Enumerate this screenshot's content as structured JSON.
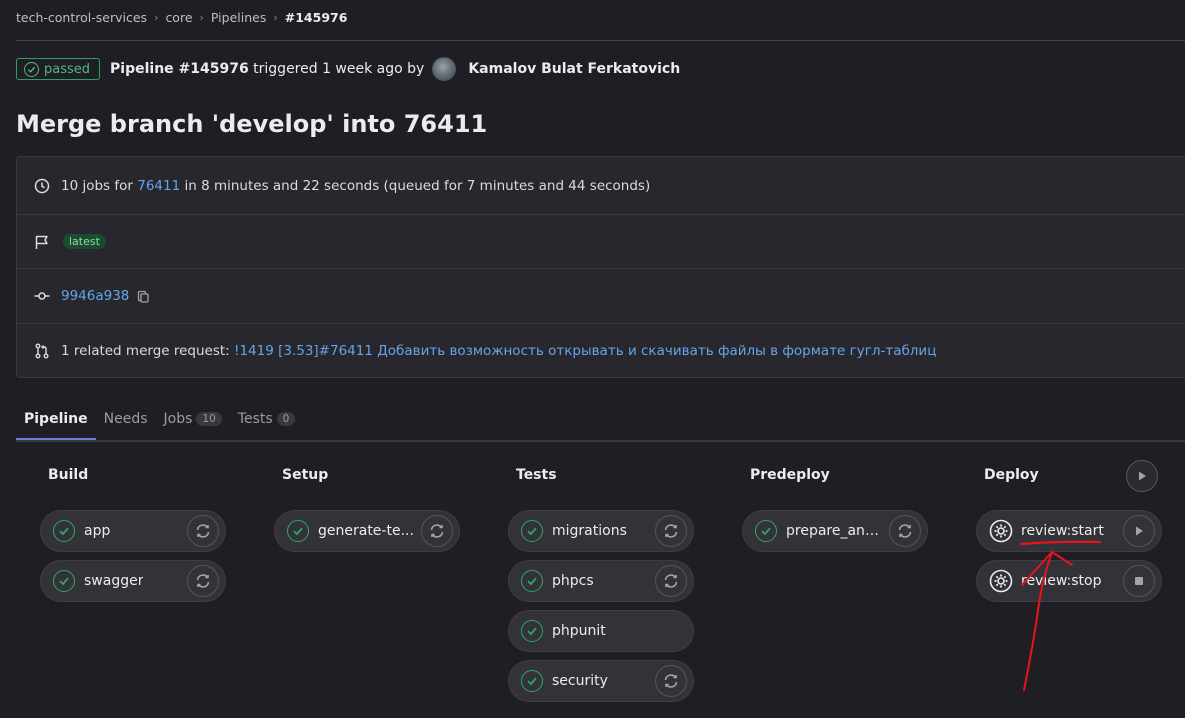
{
  "breadcrumb": {
    "items": [
      "tech-control-services",
      "core",
      "Pipelines"
    ],
    "current": "#145976"
  },
  "header": {
    "status": "passed",
    "pipeline": "Pipeline #145976",
    "triggered": "triggered 1 week ago by",
    "author": "Kamalov Bulat Ferkatovich",
    "title": "Merge branch 'develop' into 76411"
  },
  "info": {
    "jobs_prefix": "10 jobs for",
    "branch": "76411",
    "jobs_suffix": "in 8 minutes and 22 seconds (queued for 7 minutes and 44 seconds)",
    "tag": "latest",
    "commit": "9946a938",
    "mr_prefix": "1 related merge request:",
    "mr_link": "!1419 [3.53]#76411 Добавить возможность открывать и скачивать файлы в формате гугл-таблиц"
  },
  "tabs": [
    {
      "label": "Pipeline"
    },
    {
      "label": "Needs"
    },
    {
      "label": "Jobs",
      "count": "10"
    },
    {
      "label": "Tests",
      "count": "0"
    }
  ],
  "stages": [
    {
      "name": "Build",
      "jobs": [
        "app",
        "swagger"
      ]
    },
    {
      "name": "Setup",
      "jobs": [
        "generate-te..."
      ]
    },
    {
      "name": "Tests",
      "jobs": [
        "migrations",
        "phpcs",
        "phpunit",
        "security"
      ]
    },
    {
      "name": "Predeploy",
      "jobs": [
        "prepare_and_..."
      ]
    },
    {
      "name": "Deploy",
      "jobs": [
        "review:start",
        "review:stop"
      ]
    }
  ],
  "colors": {
    "success": "#2fa765",
    "link": "#63a6e9",
    "annotation": "#e8141c"
  }
}
